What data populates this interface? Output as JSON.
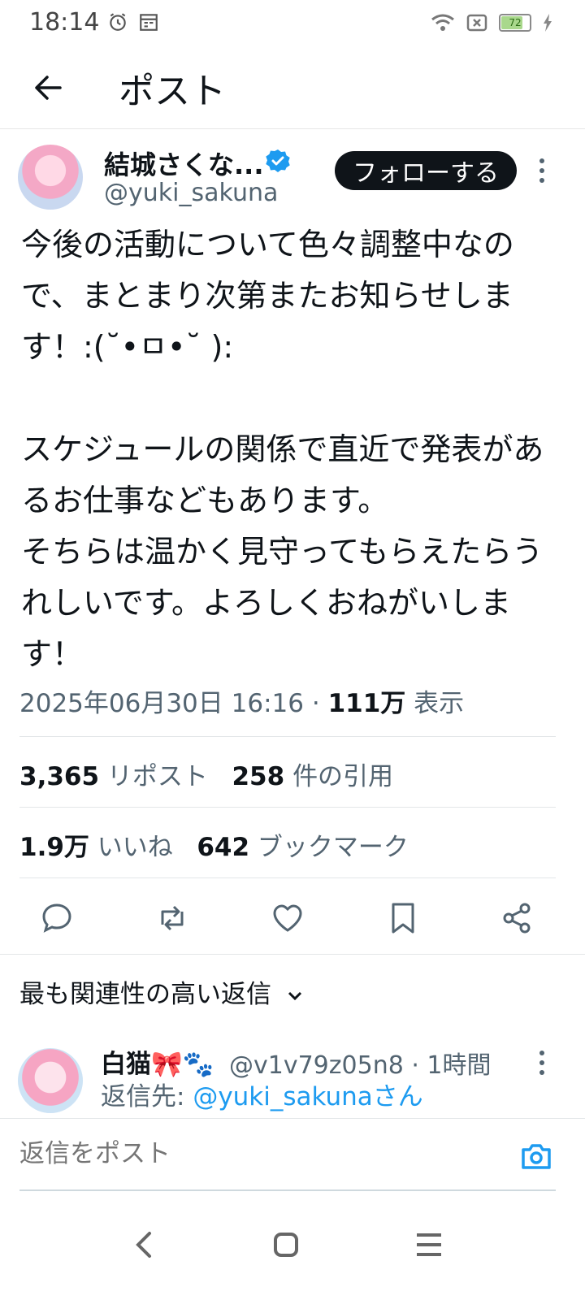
{
  "status_bar": {
    "time": "18:14",
    "battery": "72"
  },
  "header": {
    "title": "ポスト"
  },
  "post": {
    "author_name": "結城さくな...",
    "author_handle": "@yuki_sakuna",
    "follow_label": "フォローする",
    "text": "今後の活動について色々調整中なので、まとまり次第またお知らせします！:(˘•ㅁ•˘ ):\n\nスケジュールの関係で直近で発表があるお仕事などもあります。\nそちらは温かく見守ってもらえたらうれしいです。よろしくおねがいします！",
    "datetime": "2025年06月30日 16:16",
    "separator": "·",
    "views_count": "111万",
    "views_label": "表示",
    "reposts_count": "3,365",
    "reposts_label": "リポスト",
    "quotes_count": "258",
    "quotes_label": "件の引用",
    "likes_count": "1.9万",
    "likes_label": "いいね",
    "bookmarks_count": "642",
    "bookmarks_label": "ブックマーク"
  },
  "replies": {
    "sort_label": "最も関連性の高い返信",
    "items": [
      {
        "name": "白猫🎀🐾",
        "handle_time": "@v1v79z05n8 · 1時間",
        "reply_to_prefix": "返信先: ",
        "reply_to_handle": "@yuki_sakunaさん"
      }
    ]
  },
  "compose": {
    "placeholder": "返信をポスト"
  },
  "colors": {
    "accent": "#1d9bf0",
    "text": "#0f1419",
    "muted": "#536471"
  }
}
